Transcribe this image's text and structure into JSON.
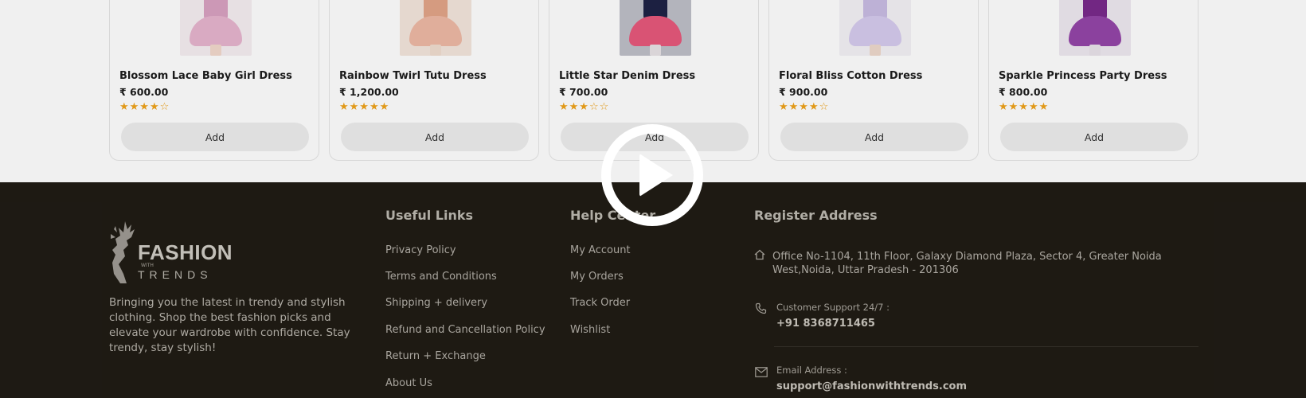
{
  "products": [
    {
      "name": "Blossom Lace Baby Girl Dress",
      "price": "₹ 600.00",
      "stars": "★★★★☆",
      "add_label": "Add",
      "colors": {
        "top": "#d9a2c2",
        "skirt": "#e7b5cf",
        "legs": "#f3d9cc",
        "bg": "#f6eef2"
      }
    },
    {
      "name": "Rainbow Twirl Tutu Dress",
      "price": "₹ 1,200.00",
      "stars": "★★★★★",
      "add_label": "Add",
      "colors": {
        "top": "#e3a589",
        "skirt": "#efb9a5",
        "legs": "#f1ddd0",
        "bg": "#f4e6dc"
      }
    },
    {
      "name": "Little Star Denim Dress",
      "price": "₹ 700.00",
      "stars": "★★★☆☆",
      "add_label": "Add",
      "colors": {
        "top": "#1e2346",
        "skirt": "#e7597c",
        "legs": "#e8e3e6",
        "bg": "#bfc0c8"
      }
    },
    {
      "name": "Floral Bliss Cotton Dress",
      "price": "₹ 900.00",
      "stars": "★★★★☆",
      "add_label": "Add",
      "colors": {
        "top": "#c9bde4",
        "skirt": "#d6cbee",
        "legs": "#eed9cc",
        "bg": "#f4f2f6"
      }
    },
    {
      "name": "Sparkle Princess Party Dress",
      "price": "₹ 800.00",
      "stars": "★★★★★",
      "add_label": "Add",
      "colors": {
        "top": "#7a2a8c",
        "skirt": "#9446a8",
        "legs": "#e9e3ea",
        "bg": "#efe9f1"
      }
    }
  ],
  "footer": {
    "brand": {
      "name": "FASHION",
      "with": "WITH",
      "trends": "TRENDS"
    },
    "tagline": "Bringing you the latest in trendy and stylish clothing. Shop the best fashion picks and elevate your wardrobe with confidence. Stay trendy, stay stylish!",
    "useful_links": {
      "title": "Useful Links",
      "items": [
        "Privacy Policy",
        "Terms and Conditions",
        "Shipping + delivery",
        "Refund and Cancellation Policy",
        "Return + Exchange",
        "About Us"
      ]
    },
    "help_center": {
      "title": "Help Center",
      "items": [
        "My Account",
        "My Orders",
        "Track Order",
        "Wishlist"
      ]
    },
    "register_address": {
      "title": "Register Address",
      "address": "Office No-1104, 11th Floor, Galaxy Diamond Plaza, Sector 4, Greater Noida West,Noida, Uttar Pradesh - 201306",
      "support_label": "Customer Support 24/7 :",
      "support_phone": "+91 8368711465",
      "email_label": "Email Address :",
      "email": "support@fashionwithtrends.com"
    }
  },
  "video": {
    "icon": "play-icon"
  },
  "colors": {
    "footer_bg": "#201c15",
    "star": "#f0a31a",
    "button_bg": "#ededed"
  }
}
